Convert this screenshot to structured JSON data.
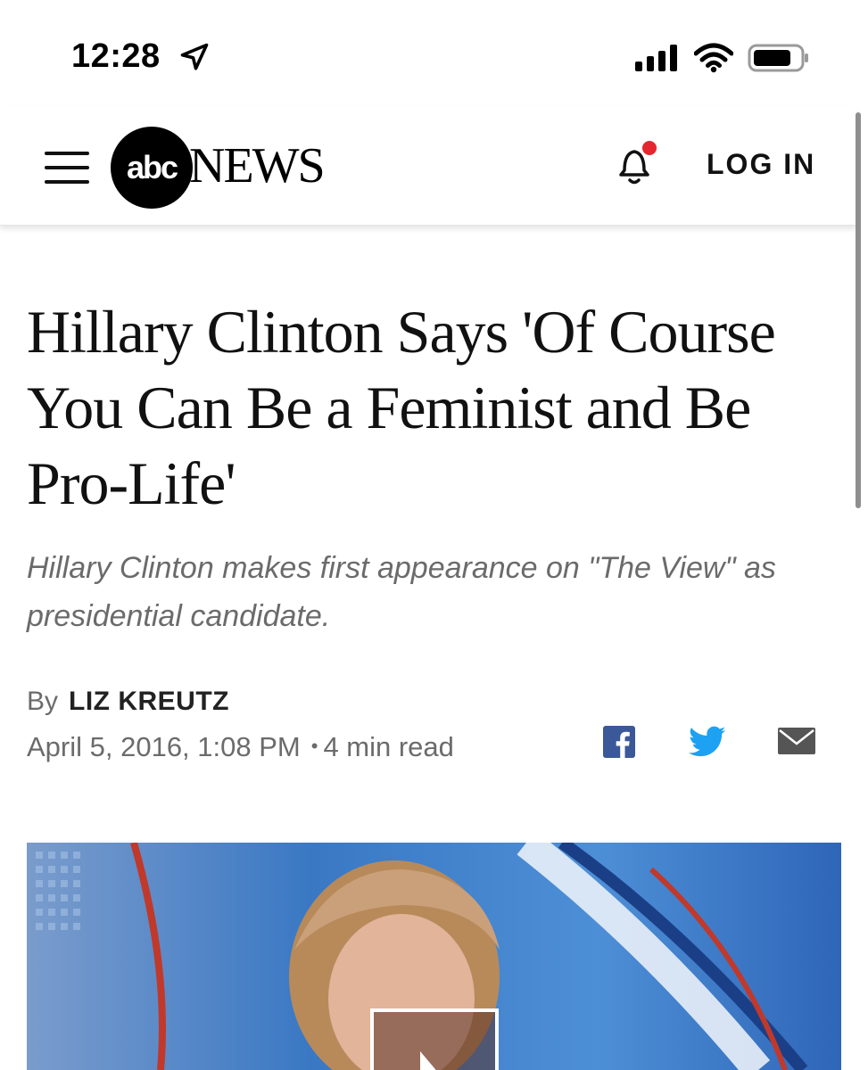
{
  "status": {
    "time": "12:28"
  },
  "header": {
    "brand_logo": "abc",
    "brand_news": "NEWS",
    "login_label": "LOG IN"
  },
  "article": {
    "headline": "Hillary Clinton Says 'Of Course You Can Be a Feminist and Be Pro-Life'",
    "subheadline": "Hillary Clinton makes first appearance on \"The View\" as presidential candidate.",
    "by_label": "By",
    "author": "LIZ KREUTZ",
    "date": "April 5, 2016, 1:08 PM",
    "separator": "•",
    "read_time": "4 min read"
  },
  "colors": {
    "facebook": "#3b5998",
    "twitter": "#1da1f2",
    "mail": "#555555",
    "notification_dot": "#e3262f"
  },
  "icons": [
    "menu-icon",
    "bell-icon",
    "facebook-icon",
    "twitter-icon",
    "mail-icon",
    "play-icon",
    "location-arrow-icon",
    "cellular-signal-icon",
    "wifi-icon",
    "battery-icon"
  ]
}
